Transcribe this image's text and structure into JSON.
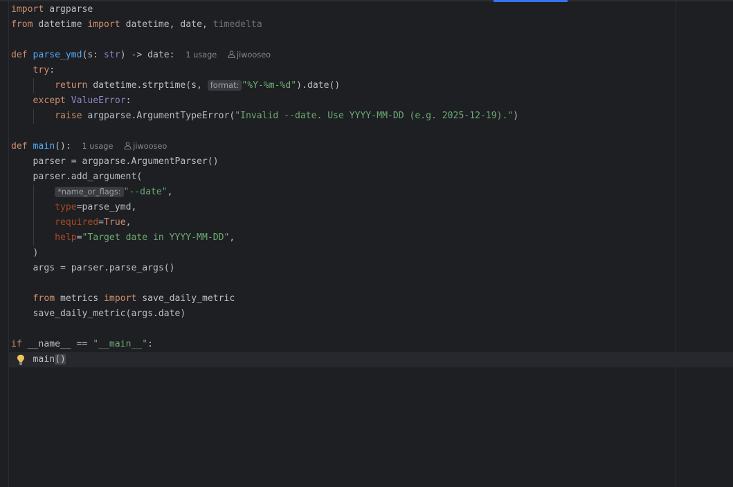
{
  "editor": {
    "usages": {
      "parse_ymd": "1 usage",
      "main": "1 usage"
    },
    "author": "jiwooseo",
    "inlay_hints": {
      "format": "format:",
      "name_or_flags": "*name_or_flags:"
    },
    "code": {
      "l1": {
        "kw": "import",
        "rest": " argparse"
      },
      "l2": {
        "kw1": "from",
        "mid1": " datetime ",
        "kw2": "import",
        "mid2": " datetime, date, ",
        "dim": "timedelta"
      },
      "l4": {
        "kw": "def",
        "sp": " ",
        "fn": "parse_ymd",
        "p1": "(s: ",
        "bi": "str",
        "p2": ") -> date:"
      },
      "l5": {
        "kw": "try",
        "rest": ":"
      },
      "l6": {
        "kw": "return",
        "rest1": " datetime.strptime(s, ",
        "str": "\"%Y-%m-%d\"",
        "rest2": ").date()"
      },
      "l7": {
        "kw": "except",
        "sp": " ",
        "bi": "ValueError",
        "rest": ":"
      },
      "l8": {
        "kw": "raise",
        "rest1": " argparse.ArgumentTypeError(",
        "str": "\"Invalid --date. Use YYYY-MM-DD (e.g. 2025-12-19).\"",
        "rest2": ")"
      },
      "l10": {
        "kw": "def",
        "sp": " ",
        "fn": "main",
        "rest": "():"
      },
      "l11": {
        "text": "parser = argparse.ArgumentParser()"
      },
      "l12": {
        "text": "parser.add_argument("
      },
      "l13": {
        "str": "\"--date\"",
        "rest": ","
      },
      "l14": {
        "param": "type",
        "rest": "=parse_ymd,"
      },
      "l15": {
        "param": "required",
        "eq": "=",
        "kw": "True",
        "rest": ","
      },
      "l16": {
        "param": "help",
        "eq": "=",
        "str": "\"Target date in YYYY-MM-DD\"",
        "rest": ","
      },
      "l17": {
        "text": ")"
      },
      "l18": {
        "text": "args = parser.parse_args()"
      },
      "l20": {
        "kw1": "from",
        "mid": " metrics ",
        "kw2": "import",
        "rest": " save_daily_metric"
      },
      "l21": {
        "text": "save_daily_metric(args.date)"
      },
      "l23": {
        "kw": "if",
        "rest1": " __name__ == ",
        "str": "\"__main__\"",
        "rest2": ":"
      },
      "l24": {
        "fn_call": "main",
        "paren": "()"
      }
    }
  },
  "colors": {
    "background": "#1e1f22",
    "keyword": "#cf8e6d",
    "function": "#56a8f5",
    "string": "#6aab73",
    "builtin": "#8888c6",
    "parameter": "#aa4926",
    "text": "#bcbec4",
    "tab_indicator": "#3574f0"
  },
  "icons": [
    "user-icon",
    "lightbulb-icon"
  ]
}
